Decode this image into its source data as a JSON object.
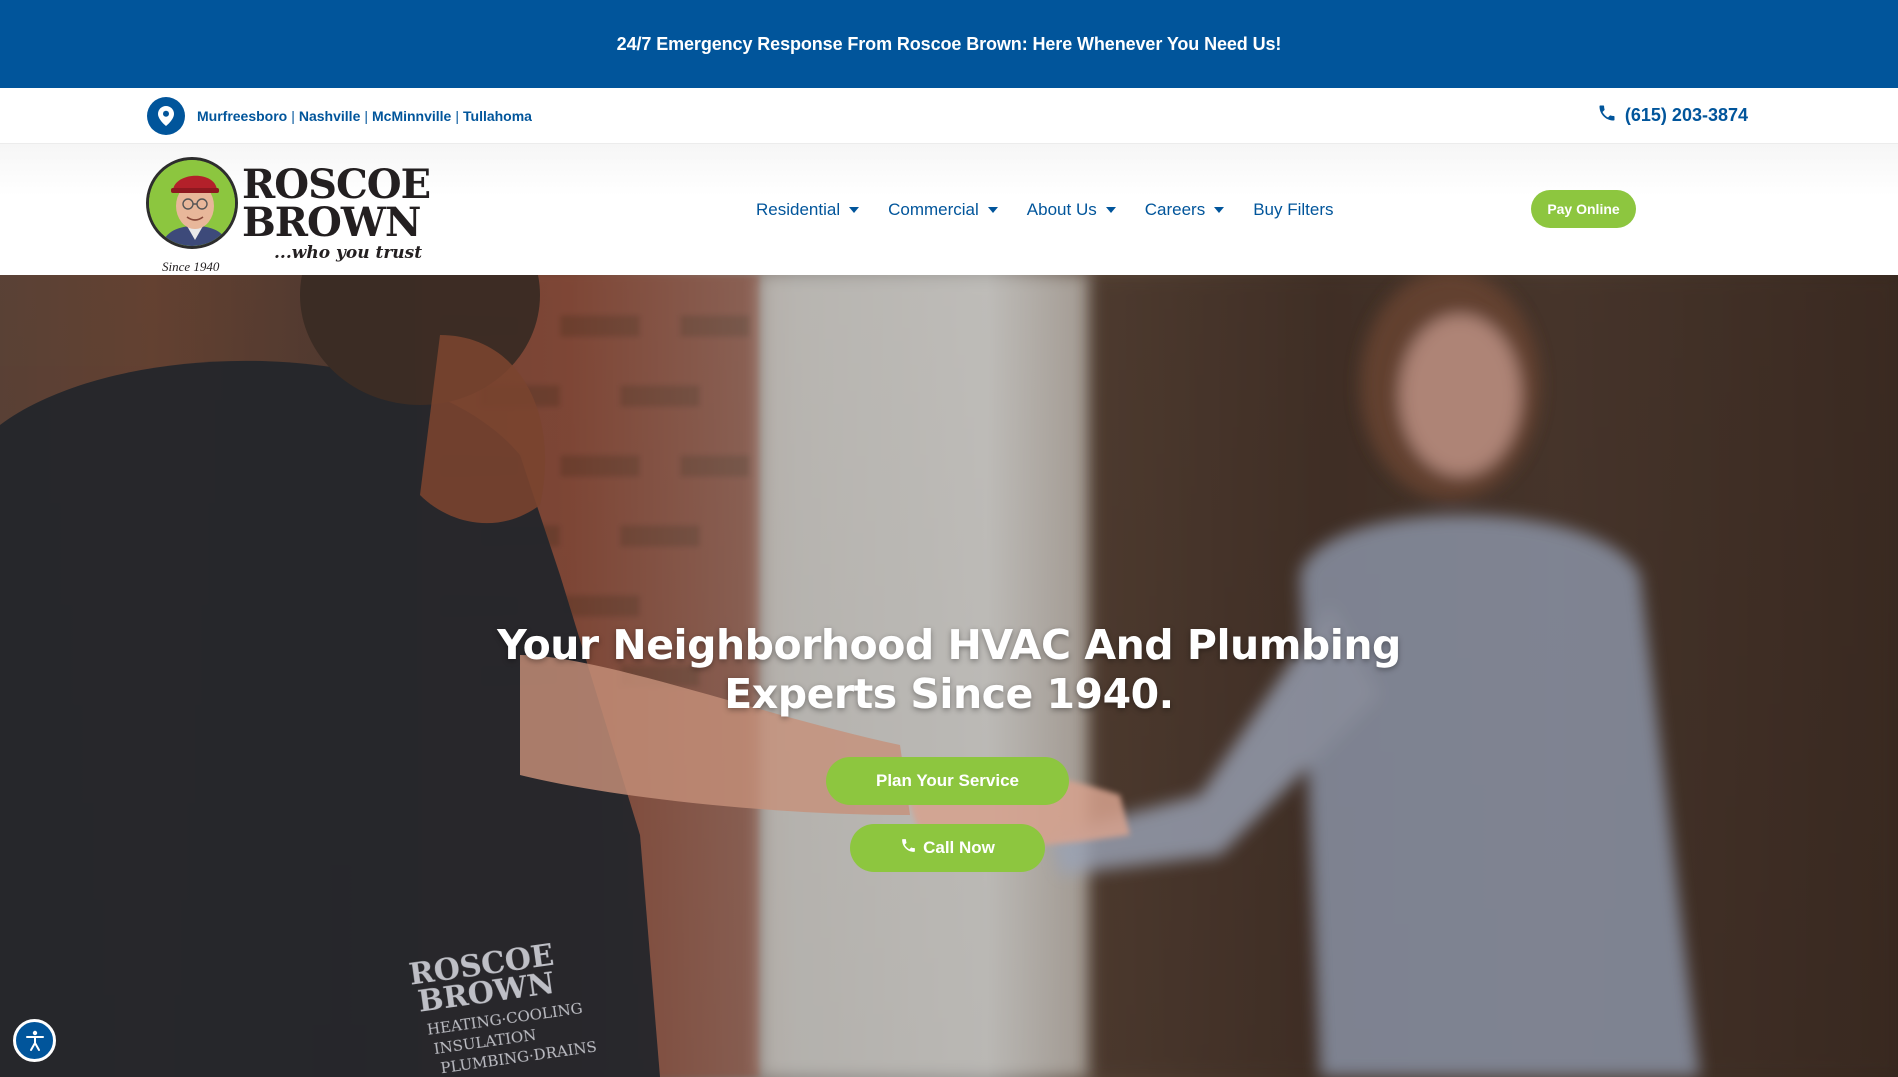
{
  "banner": {
    "text": "24/7 Emergency Response From Roscoe Brown: Here Whenever You Need Us!"
  },
  "info_bar": {
    "cities": [
      "Murfreesboro",
      "Nashville",
      "McMinnville",
      "Tullahoma"
    ],
    "separator": "|",
    "phone": "(615) 203-3874"
  },
  "logo": {
    "line1": "ROSCOE",
    "line2": "BROWN",
    "tagline": "...who you trust",
    "since": "Since 1940",
    "trademark": "™"
  },
  "nav": {
    "items": [
      {
        "label": "Residential",
        "has_dropdown": true
      },
      {
        "label": "Commercial",
        "has_dropdown": true
      },
      {
        "label": "About Us",
        "has_dropdown": true
      },
      {
        "label": "Careers",
        "has_dropdown": true
      },
      {
        "label": "Buy Filters",
        "has_dropdown": false
      }
    ],
    "pay_button": "Pay Online"
  },
  "hero": {
    "title_line1": "Your Neighborhood HVAC And Plumbing",
    "title_line2": "Experts Since 1940.",
    "plan_button": "Plan Your Service",
    "call_button": "Call Now",
    "sleeve_text": [
      "ROSCOE",
      "BROWN",
      "HEATING·COOLING",
      "INSULATION",
      "PLUMBING·DRAINS"
    ]
  },
  "colors": {
    "brand_blue": "#01559b",
    "brand_green": "#8dc63f",
    "white": "#ffffff"
  },
  "icons": {
    "location": "map-pin-icon",
    "phone": "phone-icon",
    "accessibility": "accessibility-icon"
  }
}
